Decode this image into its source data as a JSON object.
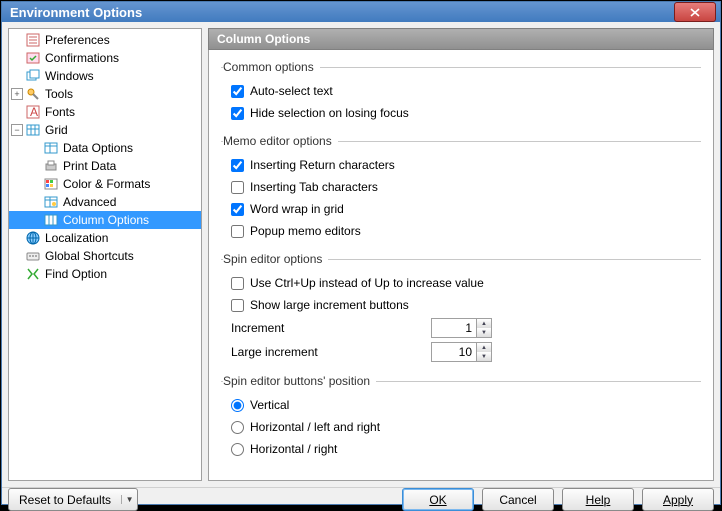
{
  "window": {
    "title": "Environment Options"
  },
  "tree": {
    "preferences": "Preferences",
    "confirmations": "Confirmations",
    "windows": "Windows",
    "tools": "Tools",
    "fonts": "Fonts",
    "grid": "Grid",
    "data_options": "Data Options",
    "print_data": "Print Data",
    "color_formats": "Color & Formats",
    "advanced": "Advanced",
    "column_options": "Column Options",
    "localization": "Localization",
    "global_shortcuts": "Global Shortcuts",
    "find_option": "Find Option"
  },
  "panel": {
    "title": "Column Options"
  },
  "groups": {
    "common": {
      "legend": "Common options",
      "auto_select": {
        "label": "Auto-select text",
        "checked": true
      },
      "hide_selection": {
        "label": "Hide selection on losing focus",
        "checked": true
      }
    },
    "memo": {
      "legend": "Memo editor options",
      "return_chars": {
        "label": "Inserting Return characters",
        "checked": true
      },
      "tab_chars": {
        "label": "Inserting Tab characters",
        "checked": false
      },
      "word_wrap": {
        "label": "Word wrap in grid",
        "checked": true
      },
      "popup": {
        "label": "Popup memo editors",
        "checked": false
      }
    },
    "spin": {
      "legend": "Spin editor options",
      "ctrl_up": {
        "label": "Use Ctrl+Up instead of Up to increase value",
        "checked": false
      },
      "large_btns": {
        "label": "Show large increment buttons",
        "checked": false
      },
      "increment_label": "Increment",
      "increment_value": "1",
      "large_increment_label": "Large increment",
      "large_increment_value": "10"
    },
    "position": {
      "legend": "Spin editor buttons' position",
      "vertical": {
        "label": "Vertical",
        "checked": true
      },
      "horiz_lr": {
        "label": "Horizontal / left and right",
        "checked": false
      },
      "horiz_r": {
        "label": "Horizontal / right",
        "checked": false
      }
    }
  },
  "footer": {
    "reset": "Reset to Defaults",
    "ok": "OK",
    "cancel": "Cancel",
    "help": "Help",
    "apply": "Apply"
  }
}
